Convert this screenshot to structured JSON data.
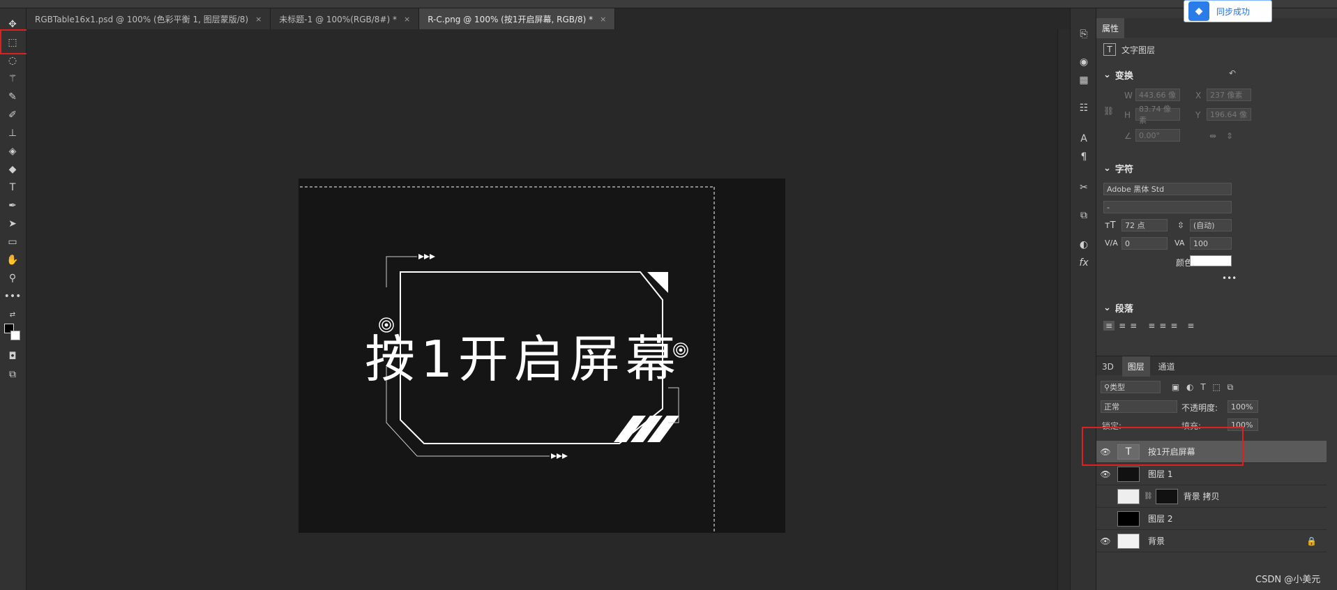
{
  "tabs": [
    {
      "label": "RGBTable16x1.psd @ 100% (色彩平衡 1, 图层蒙版/8)",
      "close": "×"
    },
    {
      "label": "未标题-1 @ 100%(RGB/8#) *",
      "close": "×"
    },
    {
      "label": "R-C.png @ 100% (按1开启屏幕, RGB/8) *",
      "close": "×"
    }
  ],
  "toolbar": {
    "icons": [
      "move-icon",
      "marquee-icon",
      "lasso-icon",
      "magic-wand-icon",
      "eyedropper-icon",
      "brush-icon",
      "stamp-icon",
      "eraser-icon",
      "paint-bucket-icon",
      "type-icon",
      "pen-icon",
      "path-select-icon",
      "rectangle-icon",
      "hand-icon",
      "zoom-icon",
      "more-icon",
      "swap-colors-icon",
      "foreground-color-icon",
      "quickmask-icon",
      "screen-mode-icon"
    ]
  },
  "canvas": {
    "text": "按1开启屏幕"
  },
  "toast": {
    "text": "同步成功"
  },
  "properties": {
    "tab": "属性",
    "layer_type": "文字图层",
    "transform": {
      "title": "变换",
      "w_label": "W",
      "w_value": "443.66 像",
      "x_label": "X",
      "x_value": "237 像素",
      "h_label": "H",
      "h_value": "83.74 像素",
      "y_label": "Y",
      "y_value": "196.64 像",
      "angle_value": "0.00°"
    },
    "character": {
      "title": "字符",
      "font": "Adobe 黑体 Std",
      "style": "-",
      "size": "72 点",
      "leading": "(自动)",
      "kerning": "0",
      "tracking": "100",
      "color_label": "颜色",
      "more": "•••"
    },
    "paragraph": {
      "title": "段落"
    }
  },
  "layers_panel": {
    "tabs": [
      "3D",
      "图层",
      "通道"
    ],
    "active_tab": "图层",
    "filter": "类型",
    "blend_mode": "正常",
    "opacity_label": "不透明度:",
    "opacity": "100%",
    "lock_label": "锁定:",
    "fill_label": "填充:",
    "fill": "100%",
    "layers": [
      {
        "name": "按1开启屏幕",
        "visible": true,
        "type": "text",
        "selected": true
      },
      {
        "name": "图层 1",
        "visible": true,
        "type": "pixel",
        "selected": false
      },
      {
        "name": "背景 拷贝",
        "visible": false,
        "type": "masked",
        "selected": false
      },
      {
        "name": "图层 2",
        "visible": false,
        "type": "pixel",
        "selected": false
      },
      {
        "name": "背景",
        "visible": true,
        "type": "background",
        "selected": false
      }
    ]
  },
  "watermark": "CSDN @小美元",
  "colors": {
    "highlight_red": "#e02020",
    "selected_row": "#5a5a5a",
    "panel_bg": "#383838",
    "canvas_bg": "#151515"
  }
}
